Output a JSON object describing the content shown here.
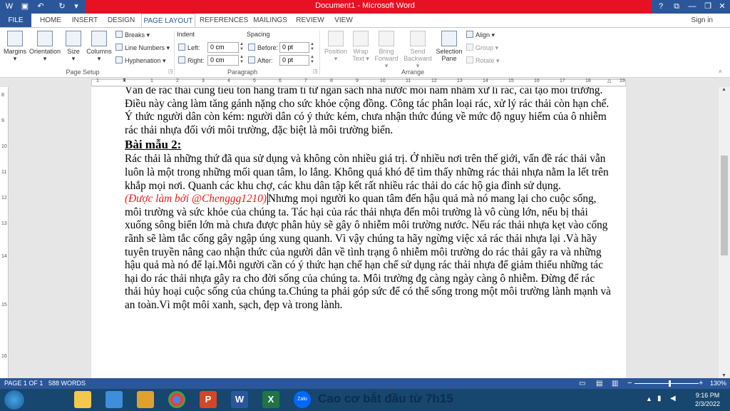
{
  "window": {
    "title": "Document1 - Microsoft Word",
    "help": "?",
    "restore_ribbon": "⧉",
    "minimize": "—",
    "maximize": "❐",
    "close": "✕"
  },
  "quick_access": {
    "save_icon": "💾",
    "undo_icon": "↶",
    "redo_icon": "↻",
    "more": "▾"
  },
  "tabs": [
    "FILE",
    "HOME",
    "INSERT",
    "DESIGN",
    "PAGE LAYOUT",
    "REFERENCES",
    "MAILINGS",
    "REVIEW",
    "VIEW"
  ],
  "active_tab": "PAGE LAYOUT",
  "account": {
    "sign_in": "Sign in"
  },
  "ribbon": {
    "page_setup": {
      "label": "Page Setup",
      "margins": "Margins",
      "orientation": "Orientation",
      "size": "Size",
      "columns": "Columns",
      "breaks": "Breaks ▾",
      "line_numbers": "Line Numbers ▾",
      "hyphenation": "Hyphenation ▾"
    },
    "paragraph": {
      "label": "Paragraph",
      "indent": "Indent",
      "spacing": "Spacing",
      "left_label": "Left:",
      "left_value": "0 cm",
      "right_label": "Right:",
      "right_value": "0 cm",
      "before_label": "Before:",
      "before_value": "0 pt",
      "after_label": "After:",
      "after_value": "0 pt"
    },
    "arrange": {
      "label": "Arrange",
      "position": "Position",
      "wrap_text": "Wrap Text ▾",
      "bring_forward": "Bring Forward ▾",
      "send_backward": "Send Backward ▾",
      "selection_pane": "Selection Pane",
      "align": "Align ▾",
      "group": "Group ▾",
      "rotate": "Rotate ▾"
    }
  },
  "ruler": {
    "marks": [
      "1",
      "1",
      "2",
      "3",
      "4",
      "5",
      "6",
      "7",
      "8",
      "9",
      "10",
      "11",
      "12",
      "13",
      "14",
      "15",
      "16",
      "17",
      "18",
      "19"
    ]
  },
  "vruler": {
    "marks": [
      "8",
      "9",
      "10",
      "11",
      "12",
      "13",
      "14",
      "15",
      "16"
    ]
  },
  "document": {
    "para1": "Vấn đề rác thải cũng tiêu tốn hàng trăm tỉ từ ngân sách nhà nước mỗi năm nhằm xử lí rác, cải tạo môi trường. Điều này càng làm tăng gánh nặng cho sức khỏe cộng đồng. Công tác phân loại rác, xử lý rác thải còn hạn chế. Ý thức người dân còn kém: người dân có ý thức kém, chưa nhận thức đúng về mức độ nguy hiểm của ô nhiễm rác thải nhựa đối với môi trường, đặc biệt là môi trường biển.",
    "heading": "Bài mẫu 2:",
    "para2_start": "Rác thải là những thứ đã qua sử dụng và không còn nhiều giá trị. Ở nhiều nơi trên thế giới, vấn đề rác thải vẫn luôn là một trong những mối quan tâm, lo lắng. Không quá khó để tìm thấy những rác thải nhựa nằm la lết trên khắp mọi nơi. Quanh các khu chợ, các khu dân tập kết rất nhiều rác thải do các hộ gia đình sử dụng.",
    "credit": "(Được làm bởi @Chenggg1210)",
    "para2_end": "Nhưng mọi người ko quan tâm đến hậu quả mà nó mang lại cho cuộc sống, môi trường và sức khỏe của chúng ta. Tác hại của rác thải nhựa đến môi trường là vô cùng lớn, nếu bị thải xuống sông biển lớn mà chưa được phân hủy sẽ gây ô nhiễm môi trường nước. Nếu rác thải nhựa kẹt vào cống rãnh sẽ làm tắc cống gây ngập úng xung quanh. Vì vậy chúng ta hãy ngừng việc xả rác thải nhựa lại .Và hãy tuyên truyền nâng cao nhận thức của người dân về tình trạng ô nhiễm môi trường do rác thải gây ra và những hậu quả mà nó để lại.Mỗi người  cần có ý thức hạn chế hạn chế sử dụng rác thải nhựa để giảm thiểu những tác hại do rác thải nhựa gây ra cho đời sống của chúng ta. Môi trường đg càng ngày càng ô nhiễm. Đừng để rác thải hủy hoại cuộc sống của chúng ta.Chúng ta phải góp sức để có thể sống trong một môi trường lành mạnh và an toàn.Vì một môi xanh, sạch, đẹp và trong lành."
  },
  "status": {
    "page": "PAGE 1 OF 1",
    "words": "588 WORDS",
    "zoom": "130%",
    "zoom_minus": "−",
    "zoom_plus": "+"
  },
  "taskbar": {
    "time": "9:16 PM",
    "date": "2/3/2022",
    "app_word": "W",
    "app_excel": "X",
    "app_ppt": "P",
    "app_zalo": "Zalo",
    "bg_text": "Cao cơ bắt đầu từ 7h15"
  },
  "colors": {
    "word_blue": "#2b579a",
    "title_red": "#e81123",
    "credit_red": "#e81c1c",
    "taskbar": "#17466f"
  }
}
